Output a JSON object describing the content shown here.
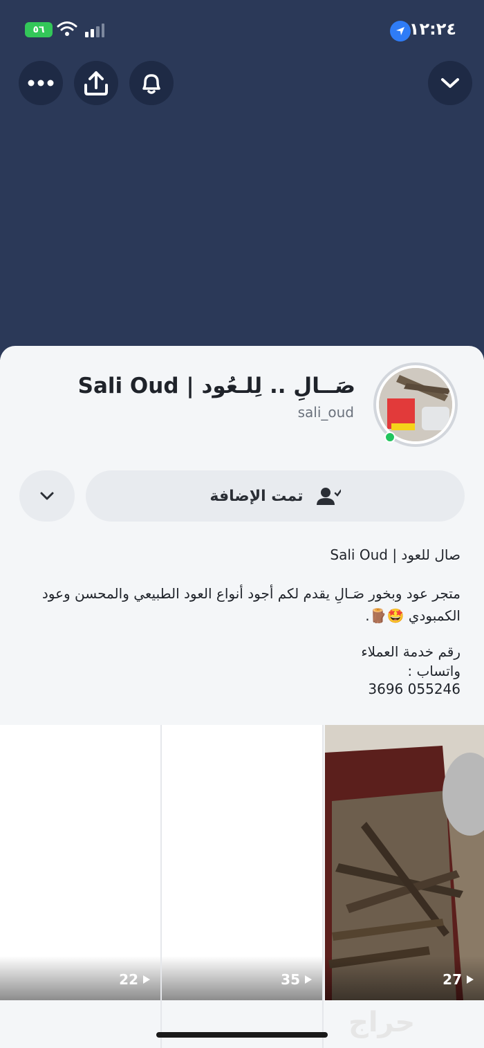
{
  "status_bar": {
    "time": "١٢:٢٤",
    "battery": "٥٦"
  },
  "header_buttons": {
    "more": "more-icon",
    "share": "share-icon",
    "notify": "bell-icon",
    "collapse": "chevron-down-icon"
  },
  "profile": {
    "display_name": "صَــالِ .. لِلـعُود | Sali Oud",
    "username": "sali_oud",
    "add_button_label": "تمت الإضافة"
  },
  "bio": {
    "title": "صال للعود | Sali Oud",
    "description": "متجر عود وبخور صَـالِ يقدم لكم أجود أنواع العود الطبيعي والمحسن وعود الكمبودي 🤩🪵.",
    "contact_label_1": "رقم خدمة العملاء",
    "contact_label_2": "واتساب :",
    "phone": "055246 3696"
  },
  "stories": [
    {
      "count": "22"
    },
    {
      "count": "35"
    },
    {
      "count": "27"
    }
  ],
  "watermark": "حراج",
  "colors": {
    "header_bg": "#2b3958",
    "sheet_bg": "#f4f6f8",
    "button_bg": "#e8ebef",
    "online": "#22c55e",
    "location_badge": "#2f7cf6"
  }
}
